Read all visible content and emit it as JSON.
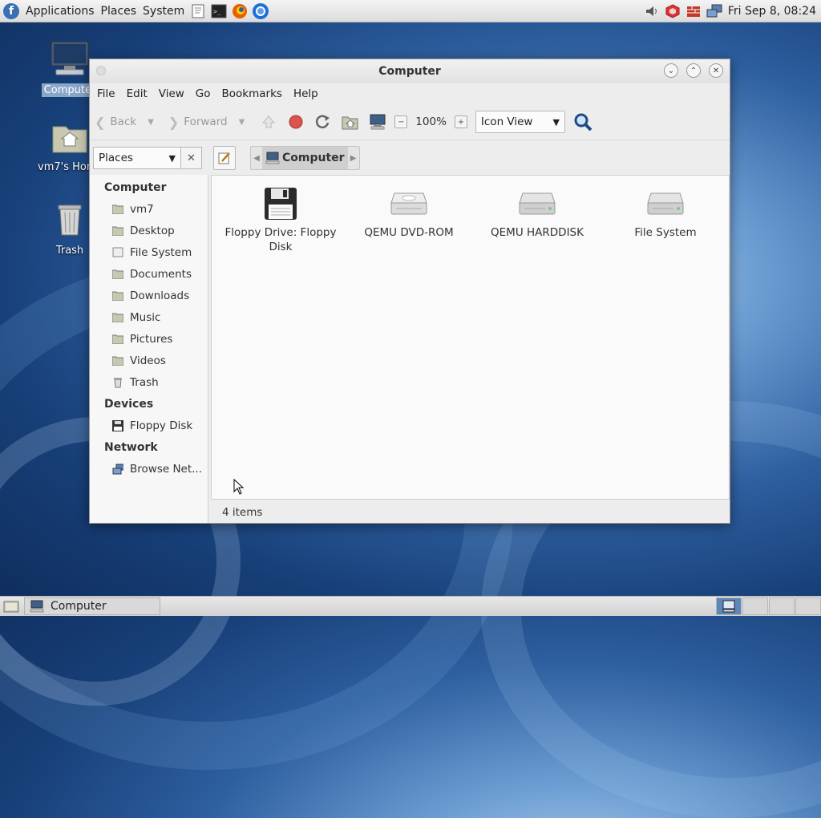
{
  "top_panel": {
    "menus": [
      "Applications",
      "Places",
      "System"
    ],
    "clock": "Fri Sep  8, 08:24"
  },
  "desktop": {
    "icons": [
      {
        "label": "Computer",
        "icon": "computer-icon",
        "selected": true
      },
      {
        "label": "vm7's Home",
        "icon": "home-folder-icon"
      },
      {
        "label": "Trash",
        "icon": "trash-icon"
      }
    ]
  },
  "window": {
    "title": "Computer",
    "menu": [
      "File",
      "Edit",
      "View",
      "Go",
      "Bookmarks",
      "Help"
    ],
    "toolbar": {
      "back": "Back",
      "forward": "Forward",
      "zoom": "100%",
      "view_mode": "Icon View"
    },
    "location": {
      "pane_selector": "Places",
      "crumb": "Computer"
    },
    "sidebar": {
      "sections": [
        {
          "heading": "Computer",
          "items": [
            {
              "label": "vm7",
              "icon": "home-icon"
            },
            {
              "label": "Desktop",
              "icon": "folder-icon"
            },
            {
              "label": "File System",
              "icon": "filesystem-icon"
            },
            {
              "label": "Documents",
              "icon": "folder-icon"
            },
            {
              "label": "Downloads",
              "icon": "folder-icon"
            },
            {
              "label": "Music",
              "icon": "music-folder-icon"
            },
            {
              "label": "Pictures",
              "icon": "pictures-folder-icon"
            },
            {
              "label": "Videos",
              "icon": "videos-folder-icon"
            },
            {
              "label": "Trash",
              "icon": "trash-icon"
            }
          ]
        },
        {
          "heading": "Devices",
          "items": [
            {
              "label": "Floppy Disk",
              "icon": "floppy-icon"
            }
          ]
        },
        {
          "heading": "Network",
          "items": [
            {
              "label": "Browse Net...",
              "icon": "network-icon"
            }
          ]
        }
      ]
    },
    "files": [
      {
        "name": "Floppy Drive: Floppy Disk",
        "icon": "floppy-drive-icon"
      },
      {
        "name": "QEMU DVD-ROM",
        "icon": "optical-drive-icon"
      },
      {
        "name": "QEMU HARDDISK",
        "icon": "harddisk-icon"
      },
      {
        "name": "File System",
        "icon": "harddisk-icon"
      }
    ],
    "status": "4 items"
  },
  "bottom_panel": {
    "task": "Computer"
  }
}
